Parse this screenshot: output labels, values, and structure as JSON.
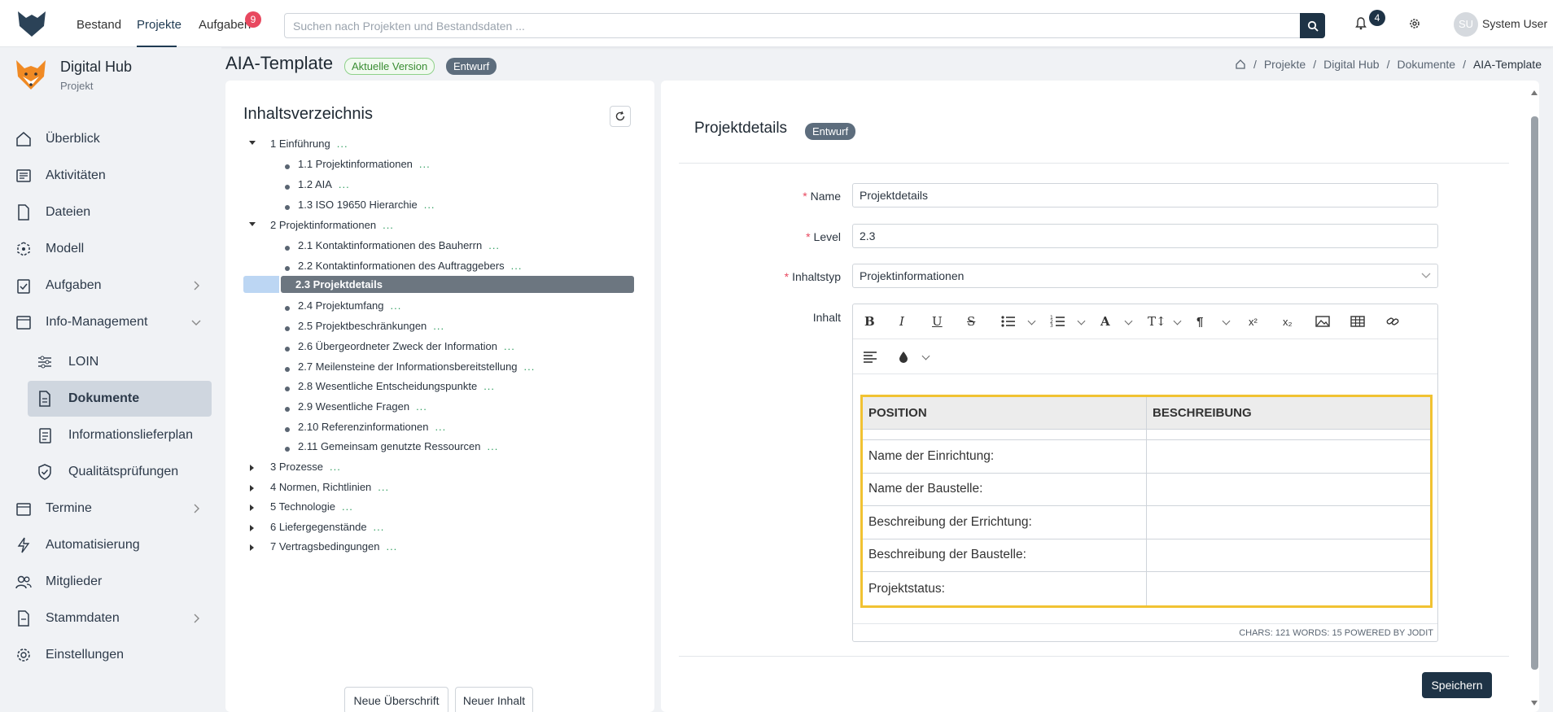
{
  "topbar": {
    "nav": [
      "Bestand",
      "Projekte",
      "Aufgaben"
    ],
    "tasks_badge": "9",
    "search_placeholder": "Suchen nach Projekten und Bestandsdaten ...",
    "notifications_badge": "4",
    "user_initials": "SU",
    "user_name": "System User"
  },
  "sidebar": {
    "brand_title": "Digital Hub",
    "brand_sub": "Projekt",
    "items": [
      {
        "label": "Überblick",
        "icon": "home-icon"
      },
      {
        "label": "Aktivitäten",
        "icon": "activity-icon"
      },
      {
        "label": "Dateien",
        "icon": "file-icon"
      },
      {
        "label": "Modell",
        "icon": "model-icon"
      },
      {
        "label": "Aufgaben",
        "icon": "clipboard-icon"
      },
      {
        "label": "Info-Management",
        "icon": "folder-icon"
      },
      {
        "label": "LOIN",
        "icon": "sliders-icon"
      },
      {
        "label": "Dokumente",
        "icon": "document-icon"
      },
      {
        "label": "Informationslieferplan",
        "icon": "plan-icon"
      },
      {
        "label": "Qualitätsprüfungen",
        "icon": "shield-icon"
      },
      {
        "label": "Termine",
        "icon": "calendar-icon"
      },
      {
        "label": "Automatisierung",
        "icon": "bolt-icon"
      },
      {
        "label": "Mitglieder",
        "icon": "users-icon"
      },
      {
        "label": "Stammdaten",
        "icon": "data-icon"
      },
      {
        "label": "Einstellungen",
        "icon": "gear-icon"
      }
    ]
  },
  "header": {
    "title": "AIA-Template",
    "tag_current": "Aktuelle Version",
    "tag_draft": "Entwurf",
    "breadcrumb": [
      "Projekte",
      "Digital Hub",
      "Dokumente",
      "AIA-Template"
    ]
  },
  "toc": {
    "title": "Inhaltsverzeichnis",
    "dots": "...",
    "rows": [
      "1 Einführung",
      "1.1 Projektinformationen",
      "1.2 AIA",
      "1.3 ISO 19650 Hierarchie",
      "2 Projektinformationen",
      "2.1 Kontaktinformationen des Bauherrn",
      "2.2 Kontaktinformationen des Auftraggebers",
      "2.3 Projektdetails",
      "2.4 Projektumfang",
      "2.5 Projektbeschränkungen",
      "2.6 Übergeordneter Zweck der Information",
      "2.7 Meilensteine der Informationsbereitstellung",
      "2.8 Wesentliche Entscheidungspunkte",
      "2.9 Wesentliche Fragen",
      "2.10 Referenzinformationen",
      "2.11 Gemeinsam genutzte Ressourcen",
      "3 Prozesse",
      "4 Normen, Richtlinien",
      "5 Technologie",
      "6 Liefergegenstände",
      "7 Vertragsbedingungen"
    ],
    "btn_heading": "Neue Überschrift",
    "btn_content": "Neuer Inhalt"
  },
  "detail": {
    "title": "Projektdetails",
    "tag": "Entwurf",
    "labels": {
      "name": "Name",
      "level": "Level",
      "type": "Inhaltstyp",
      "content": "Inhalt"
    },
    "values": {
      "name": "Projektdetails",
      "level": "2.3",
      "type": "Projektinformationen"
    },
    "table_headers": [
      "POSITION",
      "BESCHREIBUNG"
    ],
    "table_rows": [
      "Name der Einrichtung:",
      "Name der Baustelle:",
      "Beschreibung der Errichtung:",
      "Beschreibung der Baustelle:",
      "Projektstatus:"
    ],
    "status": "CHARS: 121   WORDS: 15   POWERED BY JODIT",
    "save": "Speichern"
  }
}
